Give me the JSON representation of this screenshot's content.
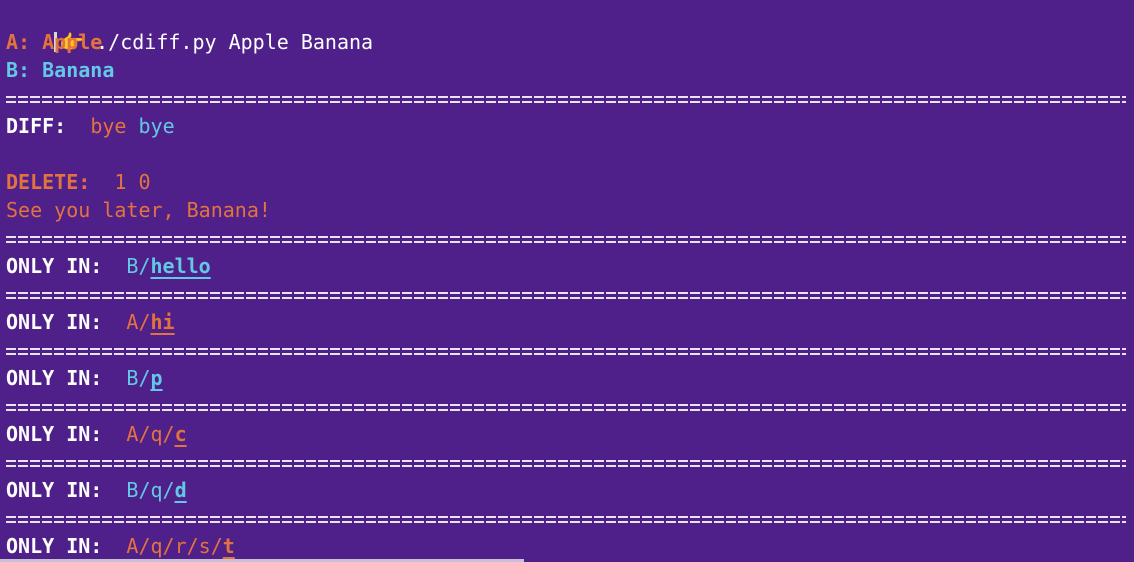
{
  "terminal": {
    "prompt_icon": "pointing-hand-icon",
    "prompt_glyph": "👉",
    "command": "./cdiff.py Apple Banana"
  },
  "header": {
    "a_label": "A: Apple",
    "b_label": "B: Banana"
  },
  "diff": {
    "label": "DIFF:",
    "value_a": "bye",
    "value_b": "bye"
  },
  "delete": {
    "label": "DELETE:",
    "value": "1 0",
    "message": "See you later, Banana!"
  },
  "only_in": {
    "label": "ONLY IN:",
    "entries": [
      {
        "side": "B",
        "prefix": "B/",
        "name": "hello"
      },
      {
        "side": "A",
        "prefix": "A/",
        "name": "hi"
      },
      {
        "side": "B",
        "prefix": "B/",
        "name": "p"
      },
      {
        "side": "A",
        "prefix": "A/q/",
        "name": "c"
      },
      {
        "side": "B",
        "prefix": "B/q/",
        "name": "d"
      },
      {
        "side": "A",
        "prefix": "A/q/r/s/",
        "name": "t"
      }
    ]
  },
  "colors": {
    "background": "#50208a",
    "side_a": "#e2733f",
    "side_b": "#63c7e6",
    "text": "#ffffff"
  }
}
